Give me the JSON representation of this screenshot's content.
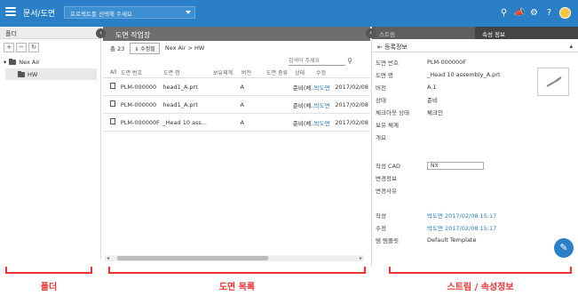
{
  "topbar": {
    "app_title": "문서/도면",
    "project_placeholder": "프로젝트를 선택해 주세요",
    "icons": [
      "search-icon",
      "megaphone-icon",
      "gear-icon",
      "help-icon",
      "avatar"
    ]
  },
  "left_panel": {
    "title": "폴더",
    "tree": [
      {
        "label": "Nex Air",
        "level": 0
      },
      {
        "label": "HW",
        "level": 1
      }
    ]
  },
  "middle_panel": {
    "title": "도면 작업장",
    "count_label": "총 23",
    "modify_button": "수정될",
    "breadcrumb": "Nex Air > HW",
    "search_placeholder": "검색어 주세요",
    "columns": [
      "All",
      "도면 번호",
      "도면 명",
      "보유체계",
      "버전",
      "도면 종류",
      "상태",
      "수정",
      ""
    ],
    "rows": [
      {
        "no": "PLM-000000",
        "name": "head1_A.prt",
        "system": "",
        "version": "A",
        "type": "",
        "state": "준비(체...",
        "modifier": "박도면",
        "date": "2017/02/08"
      },
      {
        "no": "PLM-000000",
        "name": "head1_A.prt",
        "system": "",
        "version": "A",
        "type": "",
        "state": "준비(체...",
        "modifier": "박도면",
        "date": "2017/02/08"
      },
      {
        "no": "PLM-000000F",
        "name": "_Head 10 ass...",
        "system": "",
        "version": "A",
        "type": "",
        "state": "준비(체...",
        "modifier": "박도면",
        "date": "2017/02/08"
      }
    ]
  },
  "right_panel": {
    "tabs": [
      "스트림",
      "속성 정보"
    ],
    "section_title": "등록정보",
    "fields": [
      {
        "key": "도면 번호",
        "value": "PLM-000000F"
      },
      {
        "key": "도면 명",
        "value": "_Head 10 assembly_A.prt"
      },
      {
        "key": "버전",
        "value": "A.1"
      },
      {
        "key": "상태",
        "value": "준비"
      },
      {
        "key": "체크아웃 상태",
        "value": "체크인"
      },
      {
        "key": "보유 체계",
        "value": ""
      },
      {
        "key": "개요",
        "value": ""
      }
    ],
    "cad_label": "작성 CAD",
    "cad_value": "NX",
    "change_label": "변경정보",
    "approval_label": "변경사유",
    "created_label": "작성",
    "created_value": "박도면 2017/02/08 15:17",
    "modified_label": "수정",
    "modified_value": "박도면 2017/02/08 15:17",
    "template_label": "템 템플릿",
    "template_value": "Default Template"
  },
  "annotations": {
    "folder": "폴더",
    "list": "도면 목록",
    "stream": "스트림 / 속성정보"
  }
}
